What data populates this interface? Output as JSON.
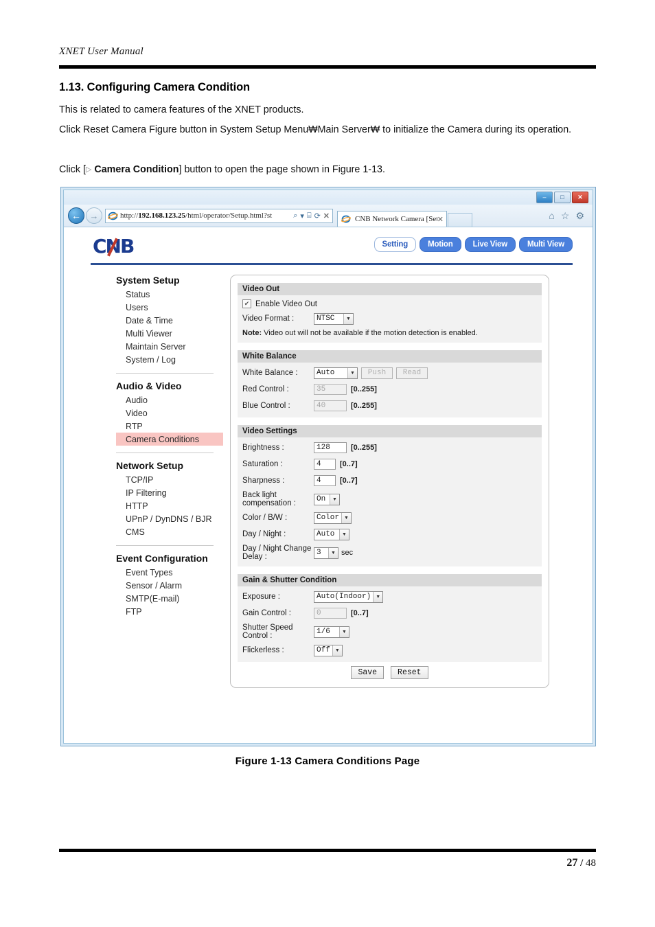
{
  "document": {
    "header_title": "XNET User Manual",
    "section_number_title": "1.13. Configuring Camera Condition",
    "paragraph_1": "This is related to camera features of the XNET products.",
    "paragraph_2": "Click Reset Camera Figure button in System Setup Menu₩Main Server₩ to initialize the Camera during its operation.",
    "paragraph_3_pre": "Click [",
    "paragraph_3_triangle": "▷",
    "paragraph_3_bold": "Camera Condition",
    "paragraph_3_post": "] button to open the page shown in Figure 1-13.",
    "figure_caption": "Figure 1-13 Camera Conditions Page",
    "page_current": "27",
    "page_separator": "/",
    "page_total": "48"
  },
  "browser": {
    "window_controls": {
      "minimize": "–",
      "maximize": "□",
      "close": "✕"
    },
    "back_glyph": "←",
    "forward_glyph": "→",
    "url_prefix": "http://",
    "url_host": "192.168.123.25",
    "url_path": "/html/operator/Setup.html?st",
    "url_search_icon": "⌕",
    "url_dropdown_icon": "▾",
    "url_compat_icon": "⌸",
    "url_refresh_icon": "⟳",
    "url_stop_icon": "✕",
    "tab_title": "CNB Network Camera [Set...",
    "tab_close": "✕",
    "cmd_home_icon": "⌂",
    "cmd_fav_icon": "☆",
    "cmd_tools_icon": "⚙"
  },
  "site": {
    "logo_text": "CNB",
    "nav_buttons": [
      {
        "label": "Setting",
        "active": true
      },
      {
        "label": "Motion",
        "active": false
      },
      {
        "label": "Live View",
        "active": false
      },
      {
        "label": "Multi View",
        "active": false
      }
    ],
    "accent_blue": "#4a80dd",
    "highlight_pink": "#f9c5c2",
    "sidebar": [
      {
        "title": "System Setup",
        "items": [
          {
            "label": "Status",
            "active": false
          },
          {
            "label": "Users",
            "active": false
          },
          {
            "label": "Date & Time",
            "active": false
          },
          {
            "label": "Multi Viewer",
            "active": false
          },
          {
            "label": "Maintain Server",
            "active": false
          },
          {
            "label": "System / Log",
            "active": false
          }
        ]
      },
      {
        "title": "Audio & Video",
        "items": [
          {
            "label": "Audio",
            "active": false
          },
          {
            "label": "Video",
            "active": false
          },
          {
            "label": "RTP",
            "active": false
          },
          {
            "label": "Camera Conditions",
            "active": true
          }
        ]
      },
      {
        "title": "Network Setup",
        "items": [
          {
            "label": "TCP/IP",
            "active": false
          },
          {
            "label": "IP Filtering",
            "active": false
          },
          {
            "label": "HTTP",
            "active": false
          },
          {
            "label": "UPnP / DynDNS / BJR",
            "active": false
          },
          {
            "label": "CMS",
            "active": false
          }
        ]
      },
      {
        "title": "Event Configuration",
        "items": [
          {
            "label": "Event Types",
            "active": false
          },
          {
            "label": "Sensor / Alarm",
            "active": false
          },
          {
            "label": "SMTP(E-mail)",
            "active": false
          },
          {
            "label": "FTP",
            "active": false
          }
        ]
      }
    ],
    "sections": {
      "video_out": {
        "title": "Video Out",
        "enable_label": "Enable Video Out",
        "enable_checked": "✔",
        "video_format_label": "Video Format :",
        "video_format_value": "NTSC",
        "note_bold": "Note:",
        "note_text": " Video out will not be available if the motion detection is enabled."
      },
      "white_balance": {
        "title": "White Balance",
        "wb_label": "White Balance :",
        "wb_value": "Auto",
        "push_label": "Push",
        "read_label": "Read",
        "red_label": "Red Control :",
        "red_value": "35",
        "red_range": "[0..255]",
        "blue_label": "Blue Control :",
        "blue_value": "40",
        "blue_range": "[0..255]"
      },
      "video_settings": {
        "title": "Video Settings",
        "brightness_label": "Brightness :",
        "brightness_value": "128",
        "brightness_range": "[0..255]",
        "saturation_label": "Saturation :",
        "saturation_value": "4",
        "saturation_range": "[0..7]",
        "sharpness_label": "Sharpness :",
        "sharpness_value": "4",
        "sharpness_range": "[0..7]",
        "blc_label": "Back light compensation :",
        "blc_value": "On",
        "color_bw_label": "Color / B/W :",
        "color_bw_value": "Color",
        "day_night_label": "Day / Night :",
        "day_night_value": "Auto",
        "dn_delay_label": "Day / Night Change Delay :",
        "dn_delay_value": "3",
        "dn_delay_unit": "sec"
      },
      "gain_shutter": {
        "title": "Gain & Shutter Condition",
        "exposure_label": "Exposure :",
        "exposure_value": "Auto(Indoor)",
        "gain_label": "Gain Control :",
        "gain_value": "0",
        "gain_range": "[0..7]",
        "shutter_label": "Shutter Speed Control :",
        "shutter_value": "1/6",
        "flickerless_label": "Flickerless :",
        "flickerless_value": "Off"
      },
      "actions": {
        "save_label": "Save",
        "reset_label": "Reset"
      }
    }
  }
}
